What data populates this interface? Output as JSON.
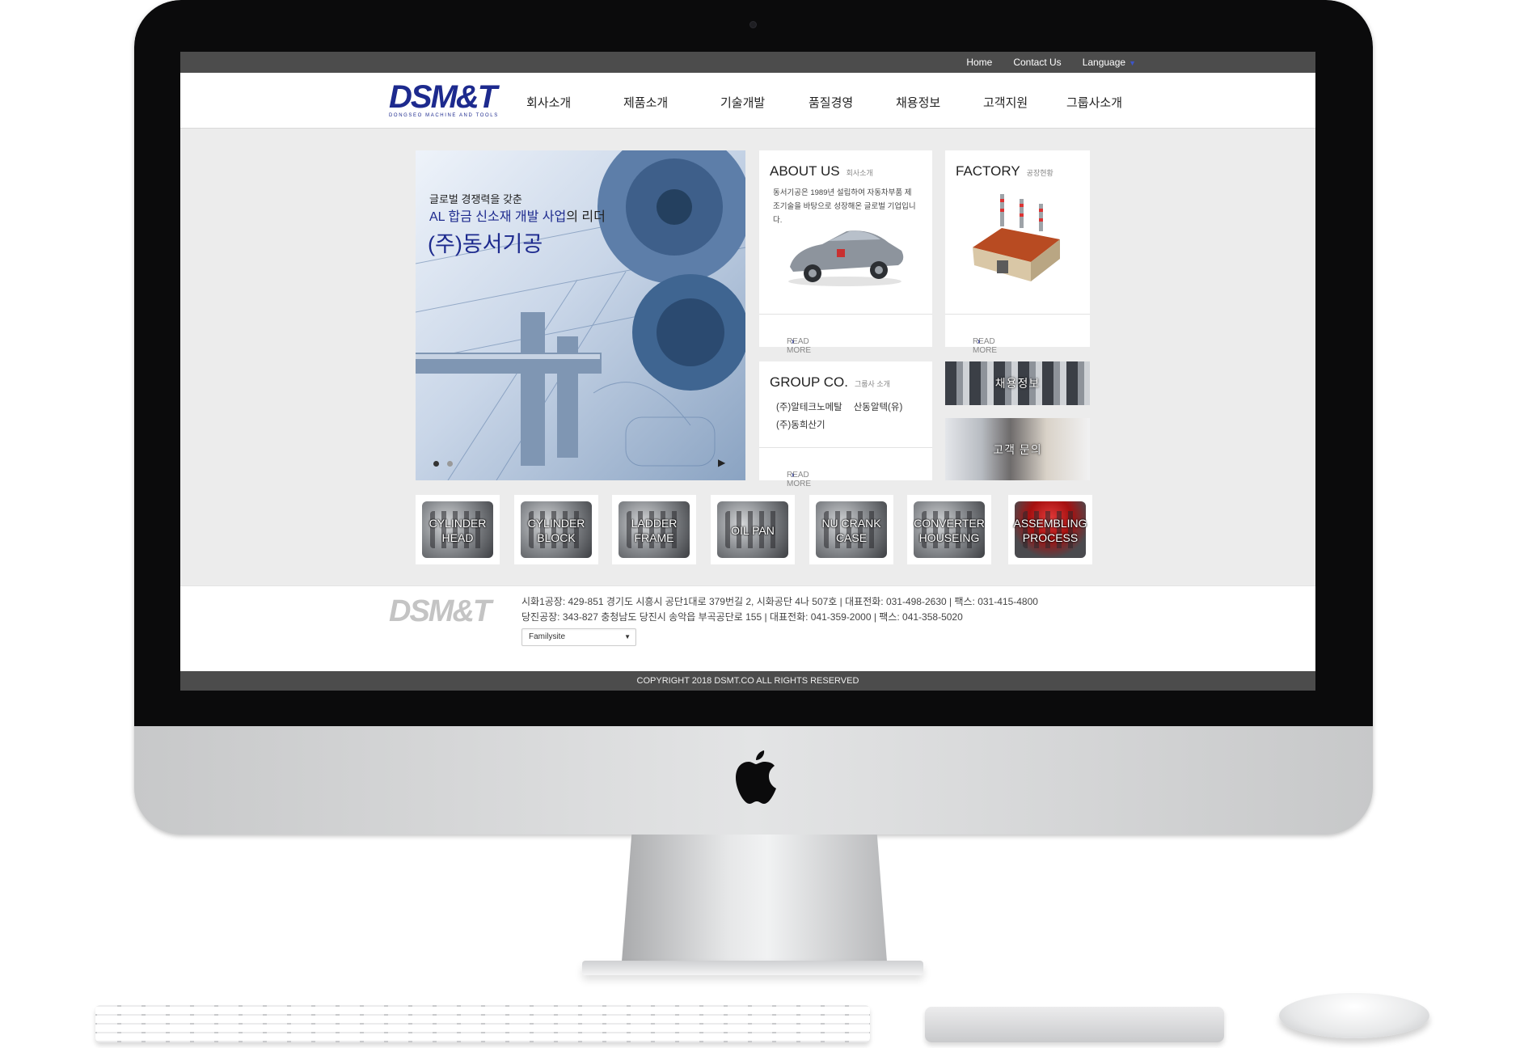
{
  "topbar": {
    "home": "Home",
    "contact": "Contact Us",
    "language": "Language"
  },
  "logo": {
    "text": "DSM&T",
    "subtitle": "DONGSEO MACHINE AND TOOLS"
  },
  "nav": [
    "회사소개",
    "제품소개",
    "기술개발",
    "품질경영",
    "채용정보",
    "고객지원",
    "그룹사소개"
  ],
  "hero": {
    "line1": "글로벌 경쟁력을 갖춘",
    "line2_highlight": "AL 합금 신소재 개발 사업",
    "line2_rest": "의 리더",
    "line3": "(주)동서기공"
  },
  "about": {
    "title": "ABOUT US",
    "subtitle": "회사소개",
    "desc": "동서기공은 1989년 설립하여 자동차부품 제조기술을 바탕으로 성장해온 글로벌 기업입니다.",
    "more": "READ MORE"
  },
  "factory": {
    "title": "FACTORY",
    "subtitle": "공장현황",
    "more": "READ MORE"
  },
  "group": {
    "title": "GROUP CO.",
    "subtitle": "그룹사 소개",
    "items": [
      "(주)알테크노메탈",
      "산동알텍(유)",
      "(주)동희산기"
    ],
    "more": "READ MORE"
  },
  "tiles": {
    "recruit": "채용정보",
    "inquiry": "고객 문의"
  },
  "products": [
    {
      "line1": "CYLINDER",
      "line2": "HEAD"
    },
    {
      "line1": "CYLINDER",
      "line2": "BLOCK"
    },
    {
      "line1": "LADDER",
      "line2": "FRAME"
    },
    {
      "line1": "OIL PAN",
      "line2": ""
    },
    {
      "line1": "NU CRANK",
      "line2": "CASE"
    },
    {
      "line1": "CONVERTER",
      "line2": "HOUSEING"
    },
    {
      "line1": "ASSEMBLING",
      "line2": "PROCESS"
    }
  ],
  "footer": {
    "logo": "DSM&T",
    "addr1": "시화1공장: 429-851 경기도 시흥시 공단1대로 379번길 2, 시화공단 4나 507호 | 대표전화: 031-498-2630 | 팩스: 031-415-4800",
    "addr2": "당진공장: 343-827 충청남도 당진시 송악읍 부곡공단로 155 | 대표전화: 041-359-2000 | 팩스: 041-358-5020",
    "familysite": "Familysite",
    "copyright": "COPYRIGHT 2018 DSMT.CO ALL RIGHTS RESERVED"
  },
  "colors": {
    "brand": "#1d2a8e",
    "topbar": "#4c4c4c",
    "page_bg": "#ececec"
  }
}
